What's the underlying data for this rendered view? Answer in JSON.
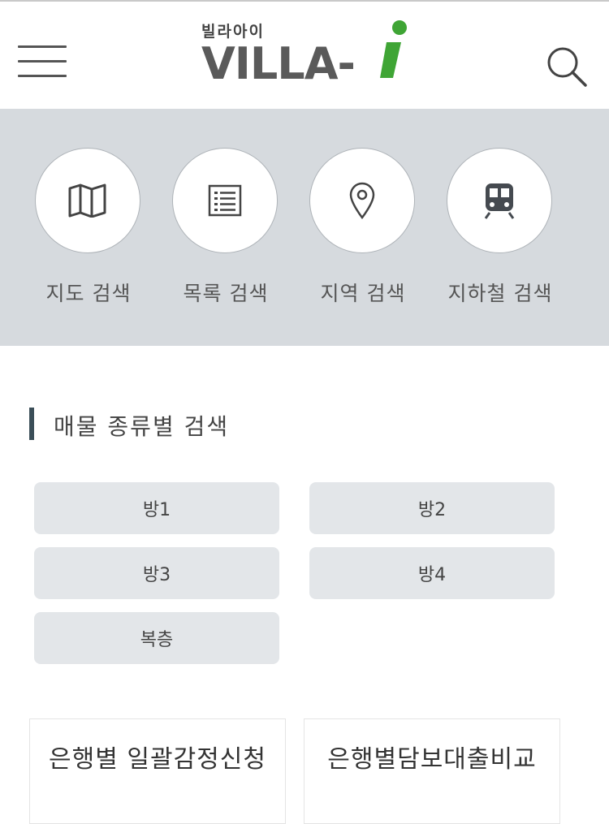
{
  "header": {
    "logo_korean": "빌라아이",
    "logo_text": "VILLA-",
    "logo_accent_color": "#3fa535",
    "menu_icon": "hamburger-menu-icon",
    "search_icon": "search-icon"
  },
  "quick_search": [
    {
      "label": "지도 검색",
      "icon": "map-icon"
    },
    {
      "label": "목록 검색",
      "icon": "list-icon"
    },
    {
      "label": "지역 검색",
      "icon": "location-pin-icon"
    },
    {
      "label": "지하철 검색",
      "icon": "subway-train-icon"
    }
  ],
  "property_types": {
    "title": "매물 종류별 검색",
    "buttons": [
      "방1",
      "방2",
      "방3",
      "방4",
      "복층"
    ]
  },
  "cards": [
    {
      "label": "은행별 일괄감정신청"
    },
    {
      "label": "은행별담보대출비교"
    }
  ]
}
